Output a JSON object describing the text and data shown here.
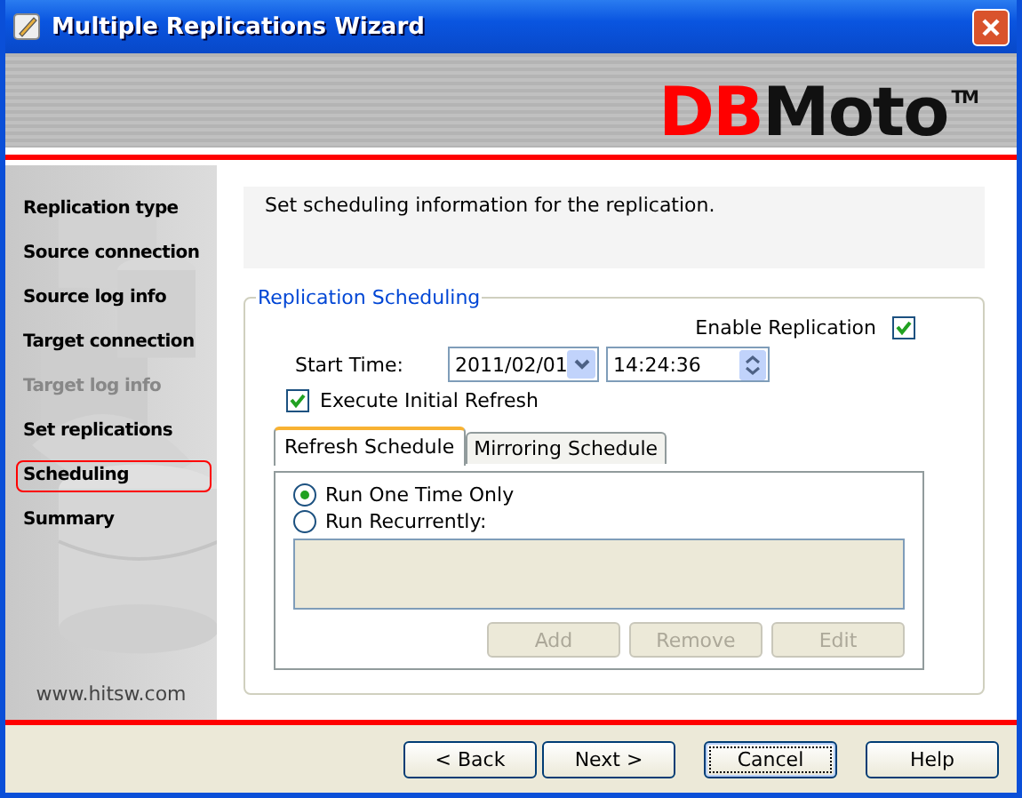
{
  "window": {
    "title": "Multiple Replications Wizard"
  },
  "banner": {
    "logo_primary": "DB",
    "logo_secondary": "Moto",
    "logo_mark": "TM"
  },
  "sidebar": {
    "items": [
      {
        "label": "Replication type",
        "selected": false,
        "disabled": false
      },
      {
        "label": "Source connection",
        "selected": false,
        "disabled": false
      },
      {
        "label": "Source log info",
        "selected": false,
        "disabled": false
      },
      {
        "label": "Target connection",
        "selected": false,
        "disabled": false
      },
      {
        "label": "Target log info",
        "selected": false,
        "disabled": true
      },
      {
        "label": "Set replications",
        "selected": false,
        "disabled": false
      },
      {
        "label": "Scheduling",
        "selected": true,
        "disabled": false
      },
      {
        "label": "Summary",
        "selected": false,
        "disabled": false
      }
    ],
    "footer": "www.hitsw.com"
  },
  "instructions": "Set scheduling information for the replication.",
  "group": {
    "title": "Replication Scheduling",
    "enable_replication": {
      "label": "Enable Replication",
      "checked": true
    },
    "start_time": {
      "label": "Start Time:",
      "date": "2011/02/01",
      "time": "14:24:36"
    },
    "initial_refresh": {
      "label": "Execute Initial Refresh",
      "checked": true
    },
    "tabs": [
      {
        "label": "Refresh Schedule",
        "selected": true
      },
      {
        "label": "Mirroring Schedule",
        "selected": false
      }
    ],
    "radios": [
      {
        "label": "Run One Time Only",
        "selected": true
      },
      {
        "label": "Run Recurrently:",
        "selected": false
      }
    ],
    "list_buttons": [
      {
        "label": "Add",
        "disabled": true
      },
      {
        "label": "Remove",
        "disabled": true
      },
      {
        "label": "Edit",
        "disabled": true
      }
    ]
  },
  "buttons": [
    {
      "label": "< Back",
      "focused": false
    },
    {
      "label": "Next >",
      "focused": false
    },
    {
      "label": "Cancel",
      "focused": true
    },
    {
      "label": "Help",
      "focused": false
    }
  ]
}
